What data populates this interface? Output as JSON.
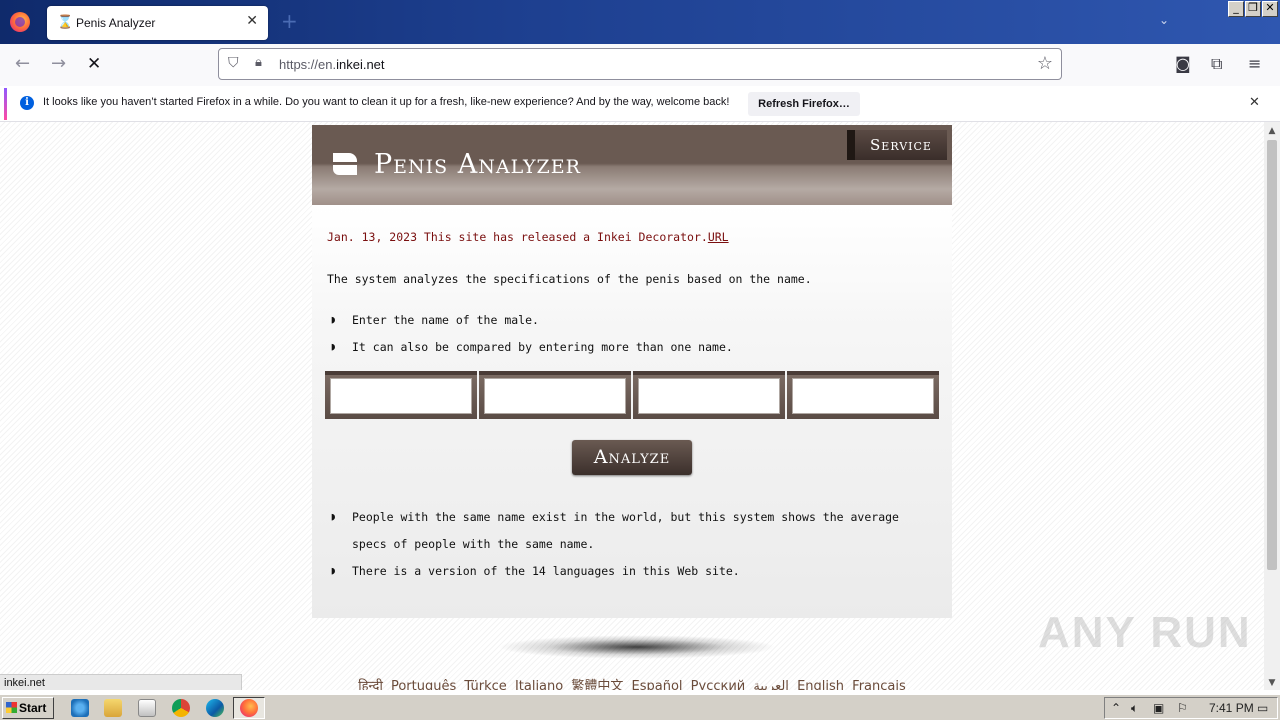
{
  "browser": {
    "tab_title": "Penis Analyzer",
    "url_prefix": "https://en.",
    "url_domain": "inkei.net",
    "notification_text": "It looks like you haven’t started Firefox in a while. Do you want to clean it up for a fresh, like-new experience? And by the way, welcome back!",
    "notification_button": "Refresh Firefox…",
    "status_text": "inkei.net"
  },
  "page": {
    "title": "Penis Analyzer",
    "service_label": "Service",
    "news_text": "Jan. 13, 2023 This site has released a Inkei Decorator.",
    "news_link": "URL",
    "intro": "The system analyzes the specifications of the penis based on the name.",
    "instructions": [
      "Enter the name of the male.",
      "It can also be compared by entering more than one name."
    ],
    "name_inputs": [
      "",
      "",
      "",
      ""
    ],
    "analyze_label": "Analyze",
    "notes": [
      "People with the same name exist in the world, but this system shows the average",
      "specs of people with the same name.",
      "There is a version of the 14 languages in this Web site."
    ],
    "languages": [
      "हिन्दी",
      "Português",
      "Türkçe",
      "Italiano",
      "繁體中文",
      "Español",
      "Русский",
      "العربية",
      "English",
      "Français"
    ]
  },
  "watermark": "ANY RUN",
  "taskbar": {
    "start_label": "Start",
    "clock": "7:41 PM"
  }
}
